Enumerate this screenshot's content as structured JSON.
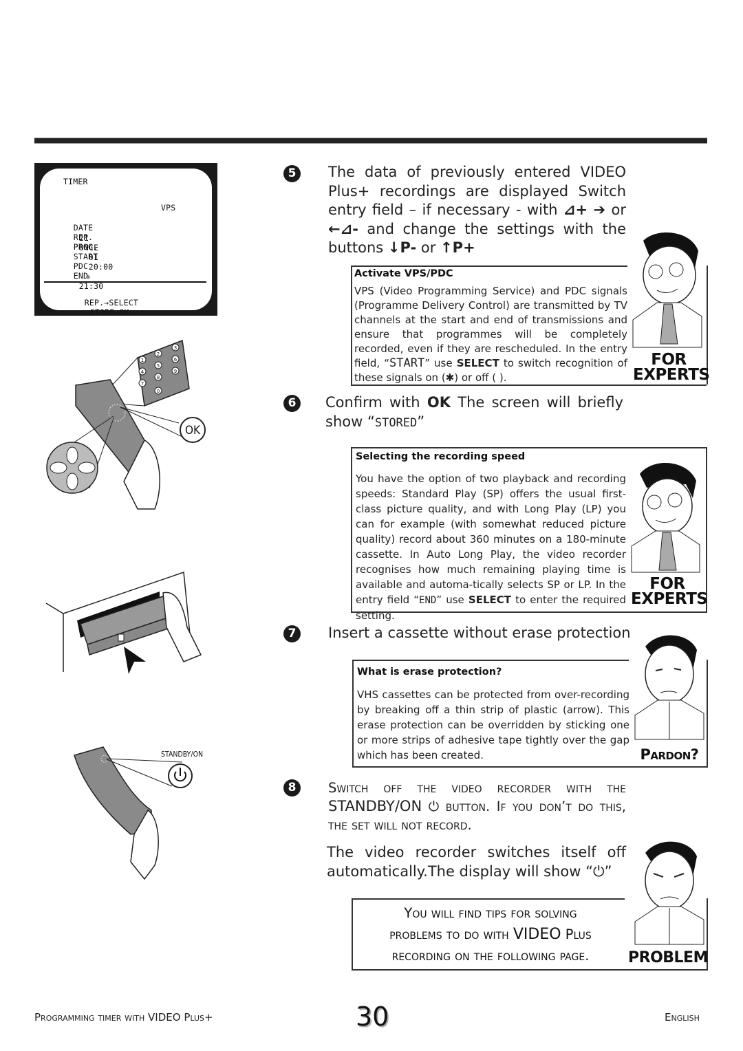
{
  "tv_screen": {
    "title": "TIMER",
    "vps_label": "VPS",
    "headers": [
      "DATE",
      "REP.",
      "PROG.",
      "START",
      "PDC",
      "END"
    ],
    "row": {
      "date": "21",
      "rep": "ONCE",
      "prog": "01",
      "start": "20:00",
      "vps_flag": "✱",
      "end": "21:30"
    },
    "footer_rep": "REP.",
    "footer_select": "SELECT",
    "footer_store": "STORE",
    "footer_ok": "OK"
  },
  "illustrations": {
    "remote_ok_label": "OK",
    "keypad_digits": [
      "1",
      "2",
      "3",
      "4",
      "5",
      "6",
      "7",
      "8",
      "9",
      "0"
    ],
    "standby_label": "STANDBY/ON"
  },
  "steps": [
    {
      "number": "5",
      "text_a": "The data of previously entered VIDEO Plus+ recordings are displayed Switch entry field – if necessary - with ",
      "sym1": "⊿+",
      "arrow_right": "➔",
      "or1": " or ",
      "arrow_left": "←",
      "sym2": "⊿-",
      "text_b": " and change the settings with the buttons ",
      "down_p": "↓P-",
      "or2": " or ",
      "up_p": "↑P+"
    },
    {
      "number": "6",
      "text_a": "Confirm with ",
      "ok": "OK",
      "text_b": " The screen will briefly show “",
      "stored": "STORED",
      "text_c": "”"
    },
    {
      "number": "7",
      "text": "Insert a cassette without erase protection"
    },
    {
      "number": "8",
      "caps_a": "Switch off the video recorder with the ",
      "standby": "STANDBY/ON",
      "power_symbol": "⏻",
      "caps_b": " button. If you don’t do this, the set will not record.",
      "text2": "The video recorder switches itself off automatically.The display will show “⏻”"
    }
  ],
  "boxes": {
    "vps_pdc": {
      "title": "Activate VPS/PDC",
      "body_a": "VPS (Video Programming Service) and PDC signals (Programme Delivery Control) are transmitted by TV channels at the start and end of transmissions and ensure that programmes will be completely recorded, even if they are rescheduled. In the entry field, “",
      "start": "START",
      "body_b": "” use ",
      "select": "SELECT",
      "body_c": " to switch recognition of these signals on (✱) or off ( ).",
      "badge_line1": "FOR",
      "badge_line2": "EXPERTS"
    },
    "recording_speed": {
      "title": "Selecting the recording speed",
      "body_a": "You have the option of two playback and recording speeds: Standard Play (SP) offers the usual first-class picture quality, and with Long Play (LP) you can for example (with somewhat reduced picture quality) record about 360 minutes on a 180-minute cassette. In Auto Long Play, the video recorder recognises how much remaining playing time is available and automa-tically selects SP or LP.  In the entry field “",
      "end": "END",
      "body_b": "” use ",
      "select": "SELECT",
      "body_c": " to enter the required setting.",
      "badge_line1": "FOR",
      "badge_line2": "EXPERTS"
    },
    "erase_protection": {
      "title": "What is erase protection?",
      "body": "VHS cassettes can be protected from over-recording by breaking off a thin strip of plastic (arrow). This erase protection can be overridden by sticking one or more strips of adhesive tape tightly over the gap which has been created.",
      "badge": "Pardon?"
    },
    "problem": {
      "line1": "You will find tips for solving",
      "line2a": "problems to do with ",
      "line2b": "VIDEO",
      "line2c": " Plus",
      "line3": "recording on the following page.",
      "badge": "PROBLEM"
    }
  },
  "footer": {
    "left": "Programming timer with VIDEO Plus+",
    "page_number": "30",
    "right": "English"
  }
}
